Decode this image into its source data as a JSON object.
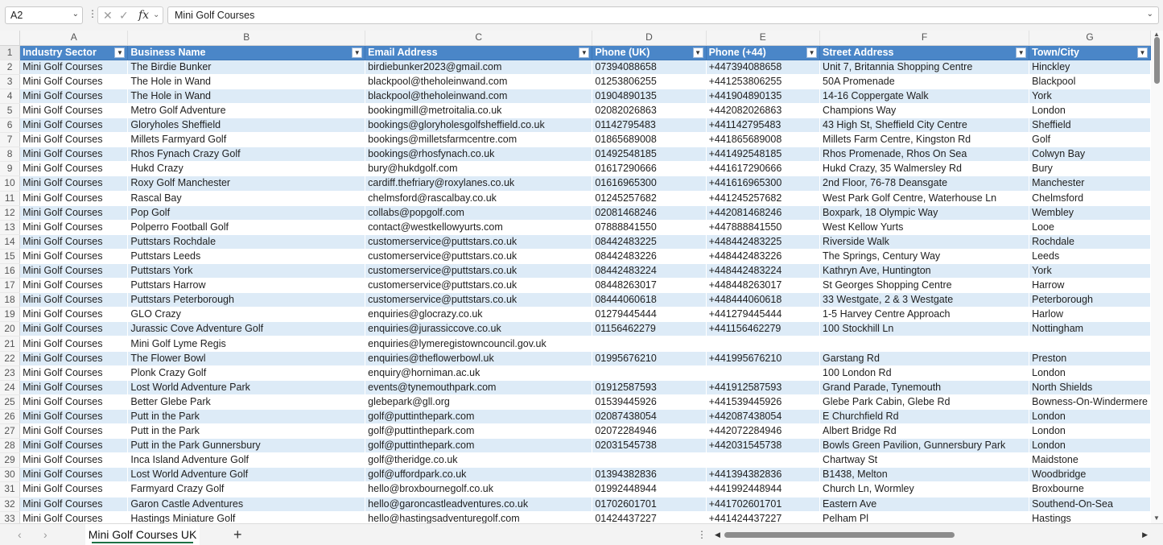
{
  "formula_bar": {
    "cell_ref": "A2",
    "formula": "Mini Golf Courses"
  },
  "columns": [
    "A",
    "B",
    "C",
    "D",
    "E",
    "F",
    "G"
  ],
  "headers": [
    "Industry Sector",
    "Business Name",
    "Email Address",
    "Phone (UK)",
    "Phone (+44)",
    "Street Address",
    "Town/City"
  ],
  "rows": [
    [
      "2",
      "Mini Golf Courses",
      "The Birdie Bunker",
      "birdiebunker2023@gmail.com",
      "07394088658",
      "+447394088658",
      "Unit 7, Britannia Shopping Centre",
      "Hinckley"
    ],
    [
      "3",
      "Mini Golf Courses",
      "The Hole in Wand",
      "blackpool@theholeinwand.com",
      "01253806255",
      "+441253806255",
      "50A Promenade",
      "Blackpool"
    ],
    [
      "4",
      "Mini Golf Courses",
      "The Hole in Wand",
      "blackpool@theholeinwand.com",
      "01904890135",
      "+441904890135",
      "14-16 Coppergate Walk",
      "York"
    ],
    [
      "5",
      "Mini Golf Courses",
      "Metro Golf Adventure",
      "bookingmill@metroitalia.co.uk",
      "02082026863",
      "+442082026863",
      "Champions Way",
      "London"
    ],
    [
      "6",
      "Mini Golf Courses",
      "Gloryholes Sheffield",
      "bookings@gloryholesgolfsheffield.co.uk",
      "01142795483",
      "+441142795483",
      "43 High St, Sheffield City Centre",
      "Sheffield"
    ],
    [
      "7",
      "Mini Golf Courses",
      "Millets Farmyard Golf",
      "bookings@milletsfarmcentre.com",
      "01865689008",
      "+441865689008",
      "Millets Farm Centre, Kingston Rd",
      "Golf"
    ],
    [
      "8",
      "Mini Golf Courses",
      "Rhos Fynach Crazy Golf",
      "bookings@rhosfynach.co.uk",
      "01492548185",
      "+441492548185",
      "Rhos Promenade, Rhos On Sea",
      "Colwyn Bay"
    ],
    [
      "9",
      "Mini Golf Courses",
      "Hukd Crazy",
      "bury@hukdgolf.com",
      "01617290666",
      "+441617290666",
      "Hukd Crazy, 35 Walmersley Rd",
      "Bury"
    ],
    [
      "10",
      "Mini Golf Courses",
      "Roxy Golf Manchester",
      "cardiff.thefriary@roxylanes.co.uk",
      "01616965300",
      "+441616965300",
      "2nd Floor, 76-78 Deansgate",
      "Manchester"
    ],
    [
      "11",
      "Mini Golf Courses",
      "Rascal Bay",
      "chelmsford@rascalbay.co.uk",
      "01245257682",
      "+441245257682",
      "West Park Golf Centre, Waterhouse Ln",
      "Chelmsford"
    ],
    [
      "12",
      "Mini Golf Courses",
      "Pop Golf",
      "collabs@popgolf.com",
      "02081468246",
      "+442081468246",
      "Boxpark, 18 Olympic Way",
      "Wembley"
    ],
    [
      "13",
      "Mini Golf Courses",
      "Polperro Football Golf",
      "contact@westkellowyurts.com",
      "07888841550",
      "+447888841550",
      "West Kellow Yurts",
      "Looe"
    ],
    [
      "14",
      "Mini Golf Courses",
      "Puttstars Rochdale",
      "customerservice@puttstars.co.uk",
      "08442483225",
      "+448442483225",
      "Riverside Walk",
      "Rochdale"
    ],
    [
      "15",
      "Mini Golf Courses",
      "Puttstars Leeds",
      "customerservice@puttstars.co.uk",
      "08442483226",
      "+448442483226",
      "The Springs, Century Way",
      "Leeds"
    ],
    [
      "16",
      "Mini Golf Courses",
      "Puttstars York",
      "customerservice@puttstars.co.uk",
      "08442483224",
      "+448442483224",
      "Kathryn Ave, Huntington",
      "York"
    ],
    [
      "17",
      "Mini Golf Courses",
      "Puttstars Harrow",
      "customerservice@puttstars.co.uk",
      "08448263017",
      "+448448263017",
      "St Georges Shopping Centre",
      "Harrow"
    ],
    [
      "18",
      "Mini Golf Courses",
      "Puttstars Peterborough",
      "customerservice@puttstars.co.uk",
      "08444060618",
      "+448444060618",
      "33 Westgate, 2 & 3 Westgate",
      "Peterborough"
    ],
    [
      "19",
      "Mini Golf Courses",
      "GLO Crazy",
      "enquiries@glocrazy.co.uk",
      "01279445444",
      "+441279445444",
      "1-5 Harvey Centre Approach",
      "Harlow"
    ],
    [
      "20",
      "Mini Golf Courses",
      "Jurassic Cove Adventure Golf",
      "enquiries@jurassiccove.co.uk",
      "01156462279",
      "+441156462279",
      "100 Stockhill Ln",
      "Nottingham"
    ],
    [
      "21",
      "Mini Golf Courses",
      "Mini Golf Lyme Regis",
      "enquiries@lymeregistowncouncil.gov.uk",
      "",
      "",
      "",
      ""
    ],
    [
      "22",
      "Mini Golf Courses",
      "The Flower Bowl",
      "enquiries@theflowerbowl.uk",
      "01995676210",
      "+441995676210",
      "Garstang Rd",
      "Preston"
    ],
    [
      "23",
      "Mini Golf Courses",
      "Plonk Crazy Golf",
      "enquiry@horniman.ac.uk",
      "",
      "",
      "100 London Rd",
      "London"
    ],
    [
      "24",
      "Mini Golf Courses",
      "Lost World Adventure Park",
      "events@tynemouthpark.com",
      "01912587593",
      "+441912587593",
      "Grand Parade, Tynemouth",
      "North Shields"
    ],
    [
      "25",
      "Mini Golf Courses",
      "Better Glebe Park",
      "glebepark@gll.org",
      "01539445926",
      "+441539445926",
      "Glebe Park Cabin, Glebe Rd",
      "Bowness-On-Windermere"
    ],
    [
      "26",
      "Mini Golf Courses",
      "Putt in the Park",
      "golf@puttinthepark.com",
      "02087438054",
      "+442087438054",
      "E Churchfield Rd",
      "London"
    ],
    [
      "27",
      "Mini Golf Courses",
      "Putt in the Park",
      "golf@puttinthepark.com",
      "02072284946",
      "+442072284946",
      "Albert Bridge Rd",
      "London"
    ],
    [
      "28",
      "Mini Golf Courses",
      "Putt in the Park Gunnersbury",
      "golf@puttinthepark.com",
      "02031545738",
      "+442031545738",
      "Bowls Green Pavilion, Gunnersbury Park",
      "London"
    ],
    [
      "29",
      "Mini Golf Courses",
      "Inca Island Adventure Golf",
      "golf@theridge.co.uk",
      "",
      "",
      "Chartway St",
      "Maidstone"
    ],
    [
      "30",
      "Mini Golf Courses",
      "Lost World Adventure Golf",
      "golf@uffordpark.co.uk",
      "01394382836",
      "+441394382836",
      "B1438, Melton",
      "Woodbridge"
    ],
    [
      "31",
      "Mini Golf Courses",
      "Farmyard Crazy Golf",
      "hello@broxbournegolf.co.uk",
      "01992448944",
      "+441992448944",
      "Church Ln, Wormley",
      "Broxbourne"
    ],
    [
      "32",
      "Mini Golf Courses",
      "Garon Castle Adventures",
      "hello@garoncastleadventures.co.uk",
      "01702601701",
      "+441702601701",
      "Eastern Ave",
      "Southend-On-Sea"
    ],
    [
      "33",
      "Mini Golf Courses",
      "Hastings Miniature Golf",
      "hello@hastingsadventuregolf.com",
      "01424437227",
      "+441424437227",
      "Pelham Pl",
      "Hastings"
    ]
  ],
  "sheet_tabs": [
    {
      "label": "Mini Golf Courses UK",
      "active": true
    }
  ],
  "colors": {
    "header_bg": "#4a86c8",
    "band_bg": "#ddebf7",
    "active_tab_underline": "#1e7145"
  },
  "icons": [
    "name-box-dropdown-icon",
    "cancel-icon",
    "enter-icon",
    "fx-icon",
    "formula-expand-icon",
    "filter-dropdown-icon",
    "scroll-up-icon",
    "scroll-down-icon",
    "prev-sheet-icon",
    "next-sheet-icon",
    "add-sheet-icon",
    "scroll-left-icon",
    "scroll-right-icon"
  ]
}
